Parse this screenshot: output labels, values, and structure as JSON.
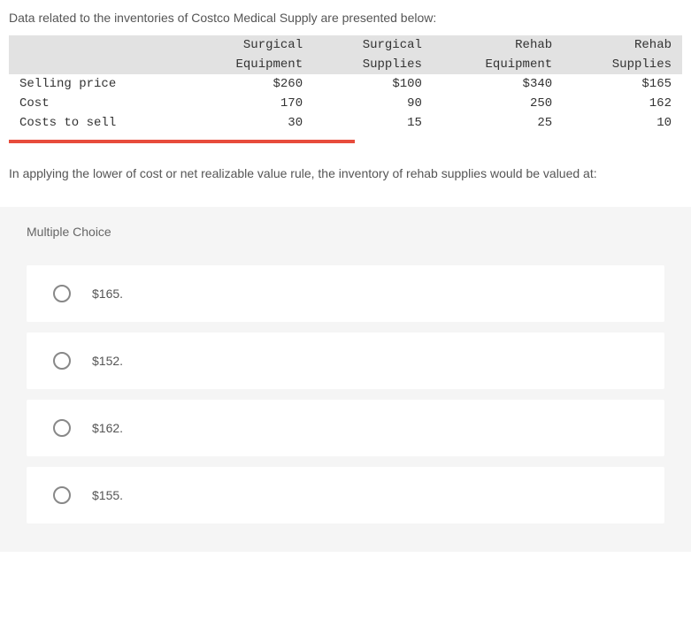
{
  "intro": "Data related to the inventories of Costco Medical Supply are presented below:",
  "table": {
    "headers": {
      "blank": "",
      "col1_line1": "Surgical",
      "col1_line2": "Equipment",
      "col2_line1": "Surgical",
      "col2_line2": "Supplies",
      "col3_line1": "Rehab",
      "col3_line2": "Equipment",
      "col4_line1": "Rehab",
      "col4_line2": "Supplies"
    },
    "rows": [
      {
        "label": "Selling price",
        "c1": "$260",
        "c2": "$100",
        "c3": "$340",
        "c4": "$165"
      },
      {
        "label": "Cost",
        "c1": "170",
        "c2": "90",
        "c3": "250",
        "c4": "162"
      },
      {
        "label": "Costs to sell",
        "c1": "30",
        "c2": "15",
        "c3": "25",
        "c4": "10"
      }
    ]
  },
  "question": "In applying the lower of cost or net realizable value rule, the inventory of rehab supplies would be valued at:",
  "mc_label": "Multiple Choice",
  "options": [
    {
      "text": "$165."
    },
    {
      "text": "$152."
    },
    {
      "text": "$162."
    },
    {
      "text": "$155."
    }
  ]
}
